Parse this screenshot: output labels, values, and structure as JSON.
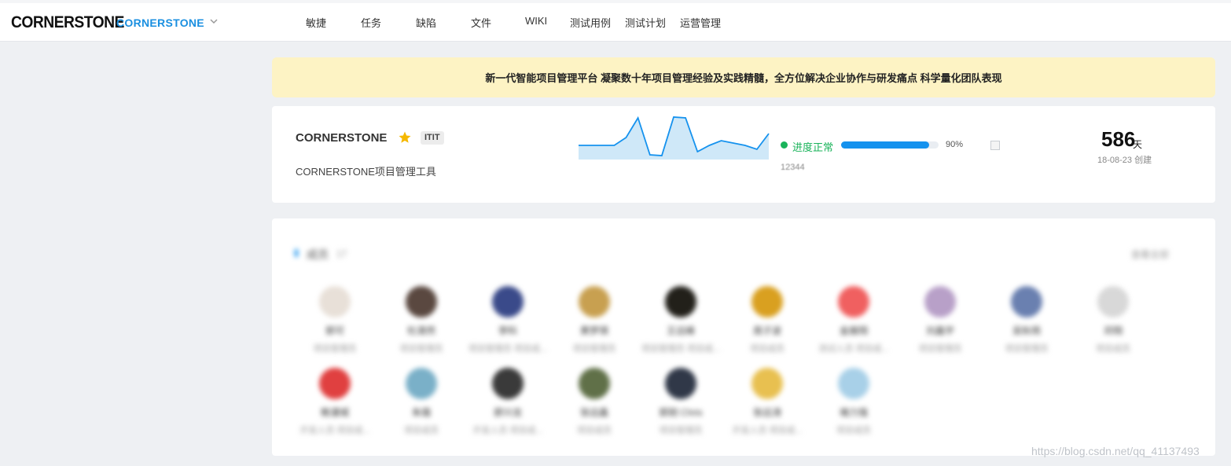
{
  "header": {
    "logo": "CORNERSTONE",
    "project_switch": "CORNERSTONE",
    "nav": [
      "敏捷",
      "任务",
      "缺陷",
      "文件",
      "WIKI",
      "测试用例",
      "测试计划",
      "运营管理"
    ]
  },
  "banner": {
    "text": "新一代智能项目管理平台 凝聚数十年项目管理经验及实践精髓，全方位解决企业协作与研发痛点 科学量化团队表现"
  },
  "overview": {
    "project_name": "CORNERSTONE",
    "tag": "ITIT",
    "description": "CORNERSTONE项目管理工具",
    "status": "进度正常",
    "progress": 0.9,
    "progress_label": "90%",
    "code": "12344",
    "days": "586",
    "days_unit": "天",
    "created": "18-08-23 创建",
    "sparkline": [
      40,
      40,
      40,
      40,
      30,
      5,
      52,
      53,
      4,
      5,
      48,
      40,
      34,
      37,
      40,
      45,
      25
    ]
  },
  "members": {
    "title": "成员",
    "count": "17",
    "view_all": "查看全部",
    "list": [
      {
        "name": "郭可",
        "role": "项目管理员",
        "color": "#e8e0d8"
      },
      {
        "name": "杜清然",
        "role": "项目管理员",
        "color": "#5a4840"
      },
      {
        "name": "李科",
        "role": "项目管理员 项目成...",
        "color": "#3a4a8a"
      },
      {
        "name": "黄梦琪",
        "role": "项目管理员",
        "color": "#c8a050"
      },
      {
        "name": "王远峰",
        "role": "项目管理员 项目成...",
        "color": "#22201a"
      },
      {
        "name": "周子波",
        "role": "项目成员",
        "color": "#d9a020"
      },
      {
        "name": "金展翔",
        "role": "测试人员 项目成...",
        "color": "#f06060"
      },
      {
        "name": "刘鑫宇",
        "role": "项目管理员",
        "color": "#b8a0c8"
      },
      {
        "name": "吴秋雨",
        "role": "项目管理员",
        "color": "#6a80b0"
      },
      {
        "name": "邓翔",
        "role": "项目成员",
        "color": "#d8d8d8"
      },
      {
        "name": "鲍漫城",
        "role": "开发人员 项目成...",
        "color": "#e04040"
      },
      {
        "name": "朱璐",
        "role": "项目成员",
        "color": "#7ab0c8"
      },
      {
        "name": "廖兴龙",
        "role": "开发人员 项目成...",
        "color": "#3a3a3a"
      },
      {
        "name": "张远鑫",
        "role": "项目成员",
        "color": "#607048"
      },
      {
        "name": "郭刚 Chris",
        "role": "项目管理员",
        "color": "#303848"
      },
      {
        "name": "张远涛",
        "role": "开发人员 项目成...",
        "color": "#e8c050"
      },
      {
        "name": "褚力强",
        "role": "项目成员",
        "color": "#a8d0e8"
      }
    ]
  },
  "watermark": "https://blog.csdn.net/qq_41137493",
  "colors": {
    "accent": "#1592ee",
    "status_green": "#19b35a",
    "banner_bg": "#fdf3c4"
  }
}
